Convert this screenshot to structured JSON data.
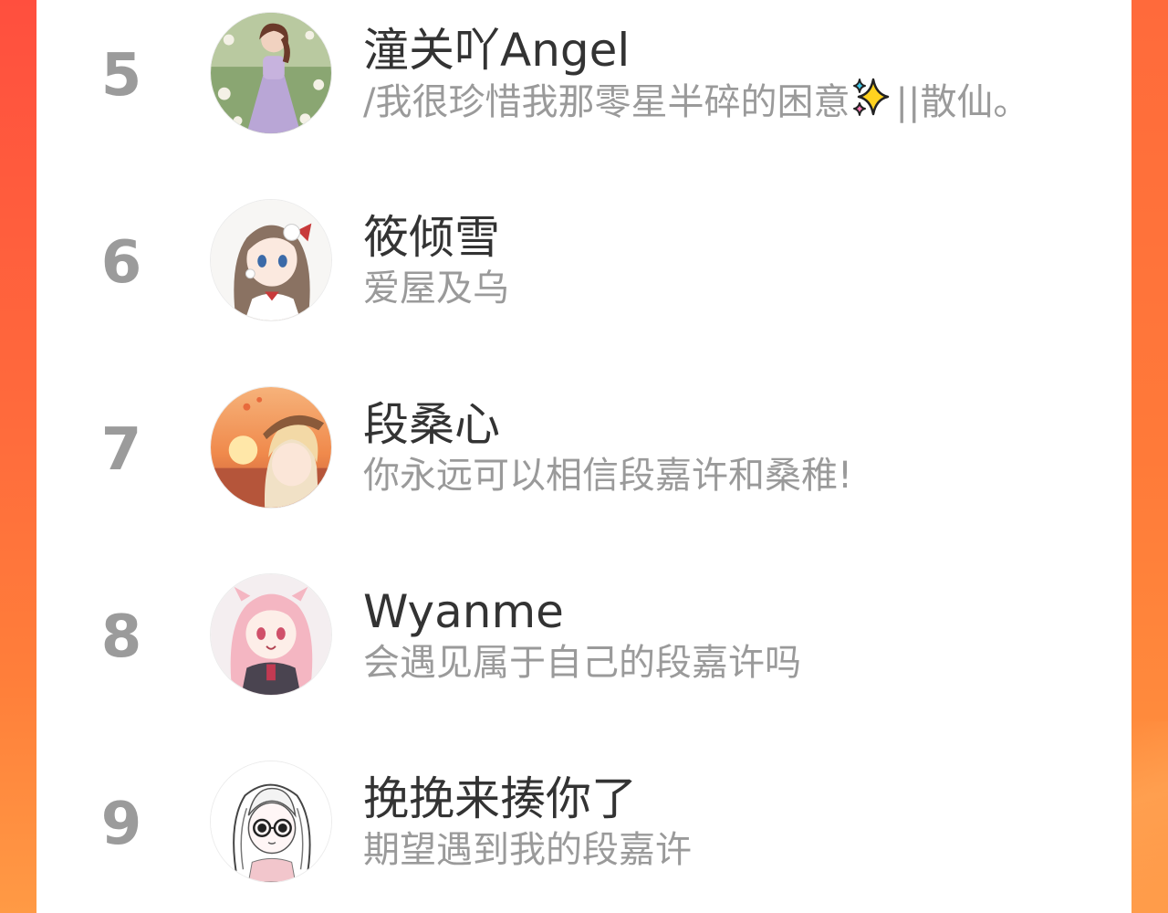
{
  "colors": {
    "background_gradient_top": "#ff4f3e",
    "background_gradient_bottom": "#ff9a45",
    "panel": "#ffffff",
    "rank_text": "#9b9b9b",
    "name_text": "#333333",
    "bio_text": "#9a9a9a"
  },
  "ranking": [
    {
      "rank": "5",
      "name": "潼关吖Angel",
      "bio_before": "/我很珍惜我那零星半碎的困意",
      "bio_icon": "sparkles-emoji",
      "bio_after": "||散仙。",
      "avatar": "girl-in-flower-field-avatar"
    },
    {
      "rank": "6",
      "name": "筱倾雪",
      "bio": "爱屋及乌",
      "avatar": "anime-girl-brown-hair-avatar"
    },
    {
      "rank": "7",
      "name": "段桑心",
      "bio": "你永远可以相信段嘉许和桑稚!",
      "avatar": "sunset-anime-girl-avatar"
    },
    {
      "rank": "8",
      "name": "Wyanme",
      "bio": "会遇见属于自己的段嘉许吗",
      "avatar": "pink-hair-anime-girl-avatar"
    },
    {
      "rank": "9",
      "name": "挽挽来揍你了",
      "bio": "期望遇到我的段嘉许",
      "avatar": "sketch-girl-glasses-avatar"
    }
  ]
}
